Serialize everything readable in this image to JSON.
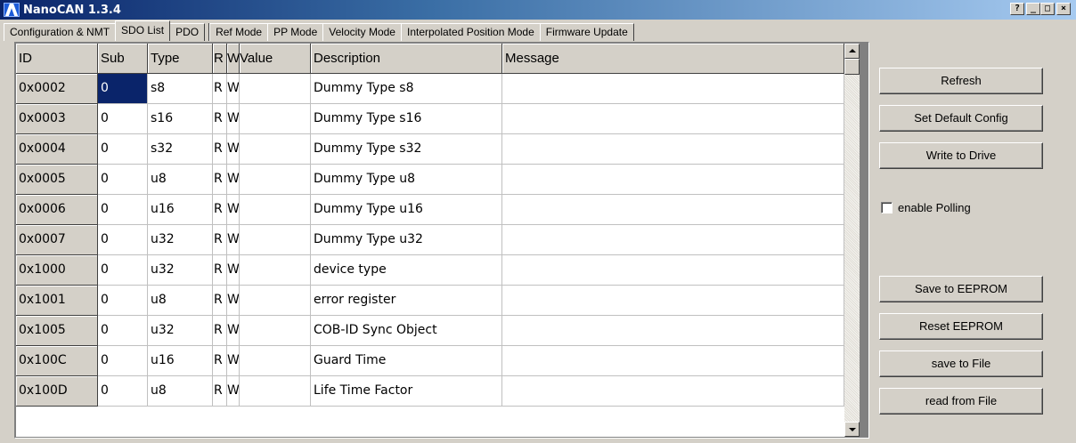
{
  "window": {
    "title": "NanoCAN 1.3.4",
    "controls": {
      "help": "?",
      "minimize": "_",
      "maximize": "□",
      "close": "×"
    }
  },
  "tabs": [
    {
      "label": "Configuration & NMT",
      "active": false
    },
    {
      "label": "SDO List",
      "active": true
    },
    {
      "label": "PDO",
      "active": false
    },
    {
      "label": "Ref Mode",
      "active": false
    },
    {
      "label": "PP Mode",
      "active": false
    },
    {
      "label": "Velocity Mode",
      "active": false
    },
    {
      "label": "Interpolated Position Mode",
      "active": false
    },
    {
      "label": "Firmware Update",
      "active": false
    }
  ],
  "grid": {
    "columns": [
      "ID",
      "Sub",
      "Type",
      "R",
      "W",
      "Value",
      "Description",
      "Message"
    ],
    "rows": [
      {
        "id": "0x0002",
        "sub": "0",
        "type": "s8",
        "r": "R",
        "w": "W",
        "value": "",
        "description": "Dummy Type s8",
        "message": ""
      },
      {
        "id": "0x0003",
        "sub": "0",
        "type": "s16",
        "r": "R",
        "w": "W",
        "value": "",
        "description": "Dummy Type s16",
        "message": ""
      },
      {
        "id": "0x0004",
        "sub": "0",
        "type": "s32",
        "r": "R",
        "w": "W",
        "value": "",
        "description": "Dummy Type s32",
        "message": ""
      },
      {
        "id": "0x0005",
        "sub": "0",
        "type": "u8",
        "r": "R",
        "w": "W",
        "value": "",
        "description": "Dummy Type u8",
        "message": ""
      },
      {
        "id": "0x0006",
        "sub": "0",
        "type": "u16",
        "r": "R",
        "w": "W",
        "value": "",
        "description": "Dummy Type u16",
        "message": ""
      },
      {
        "id": "0x0007",
        "sub": "0",
        "type": "u32",
        "r": "R",
        "w": "W",
        "value": "",
        "description": "Dummy Type u32",
        "message": ""
      },
      {
        "id": "0x1000",
        "sub": "0",
        "type": "u32",
        "r": "R",
        "w": "W",
        "value": "",
        "description": "device type",
        "message": ""
      },
      {
        "id": "0x1001",
        "sub": "0",
        "type": "u8",
        "r": "R",
        "w": "W",
        "value": "",
        "description": "error register",
        "message": ""
      },
      {
        "id": "0x1005",
        "sub": "0",
        "type": "u32",
        "r": "R",
        "w": "W",
        "value": "",
        "description": "COB-ID Sync Object",
        "message": ""
      },
      {
        "id": "0x100C",
        "sub": "0",
        "type": "u16",
        "r": "R",
        "w": "W",
        "value": "",
        "description": "Guard Time",
        "message": ""
      },
      {
        "id": "0x100D",
        "sub": "0",
        "type": "u8",
        "r": "R",
        "w": "W",
        "value": "",
        "description": "Life Time Factor",
        "message": ""
      }
    ]
  },
  "panel": {
    "refresh": "Refresh",
    "set_default": "Set Default Config",
    "write_drive": "Write to Drive",
    "enable_polling": "enable Polling",
    "save_eeprom": "Save to EEPROM",
    "reset_eeprom": "Reset EEPROM",
    "save_file": "save to File",
    "read_file": "read from File"
  }
}
